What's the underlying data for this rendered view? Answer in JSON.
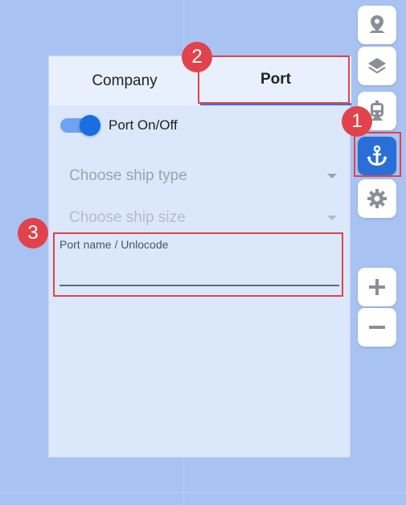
{
  "tabs": {
    "company": "Company",
    "port": "Port"
  },
  "toggle": {
    "label": "Port On/Off",
    "on": true
  },
  "selects": {
    "ship_type_placeholder": "Choose ship type",
    "ship_size_placeholder": "Choose ship size"
  },
  "port_field": {
    "label": "Port name / Unlocode",
    "value": ""
  },
  "annotations": {
    "step1": "1",
    "step2": "2",
    "step3": "3"
  },
  "toolbar": {
    "icons": [
      "location-pin-icon",
      "layers-icon",
      "train-icon",
      "anchor-icon",
      "gear-icon",
      "plus-icon",
      "minus-icon"
    ],
    "active": "anchor-icon"
  },
  "colors": {
    "accent": "#2a6fd8",
    "highlight": "#e0434b",
    "panel_bg": "#dbe7fb",
    "map_bg": "#a8c3f1"
  }
}
